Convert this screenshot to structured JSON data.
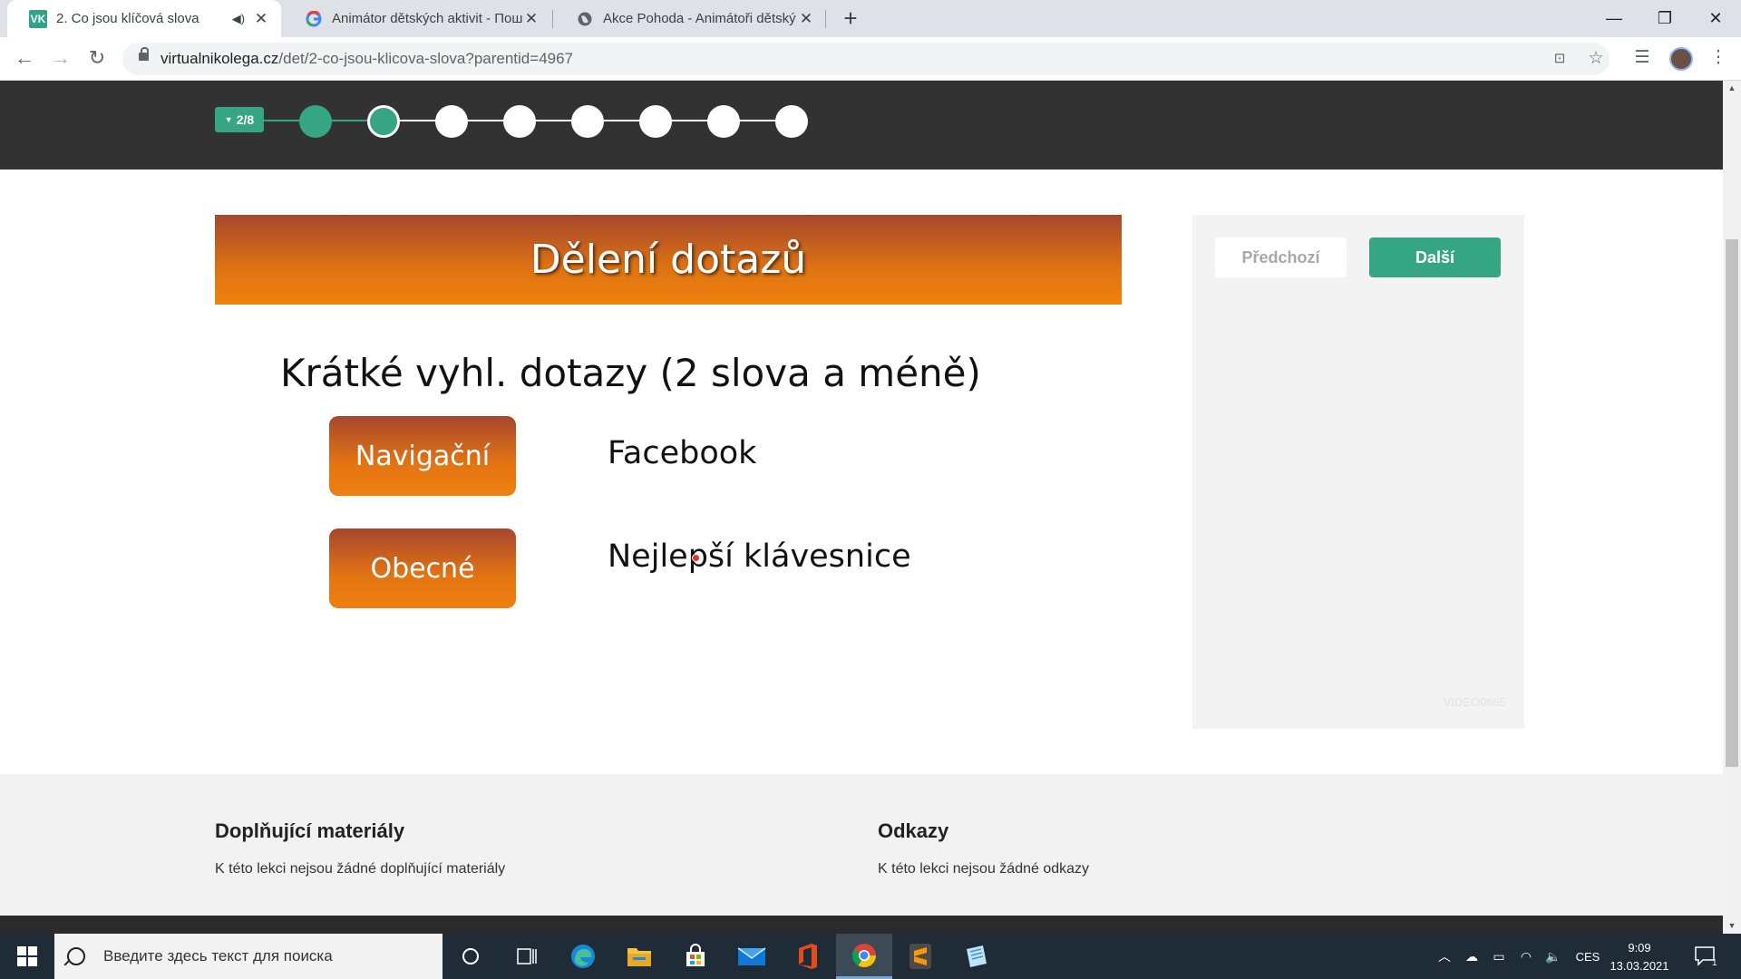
{
  "browser": {
    "tabs": [
      {
        "title": "2. Co jsou klíčová slova",
        "favicon": "vk",
        "active": true,
        "audio": true
      },
      {
        "title": "Animátor dětských aktivit - Пошу",
        "favicon": "google"
      },
      {
        "title": "Akce Pohoda - Animátoři dětský",
        "favicon": "globe"
      }
    ],
    "favicon_vk": "VK",
    "url_domain": "virtualnikolega.cz",
    "url_path": "/det/2-co-jsou-klicova-slova?parentid=4967"
  },
  "progress": {
    "badge": "2/8",
    "total_steps": 8,
    "current_step": 2
  },
  "slide": {
    "title": "Dělení dotazů",
    "subtitle": "Krátké vyhl. dotazy (2 slova a méně)",
    "rows": [
      {
        "category": "Navigační",
        "example": "Facebook"
      },
      {
        "category": "Obecné",
        "example": "Nejlepší klávesnice"
      }
    ],
    "playback_fraction": 0.95
  },
  "side_panel": {
    "prev_label": "Předchozí",
    "next_label": "Další",
    "video_code": "VIDEO0665"
  },
  "footer": {
    "materials_title": "Doplňující materiály",
    "materials_text": "K této lekci nejsou žádné doplňující materiály",
    "links_title": "Odkazy",
    "links_text": "K této lekci nejsou žádné odkazy"
  },
  "taskbar": {
    "search_placeholder": "Введите здесь текст для поиска",
    "language": "CES",
    "time": "9:09",
    "date": "13.03.2021",
    "notification_count": "1"
  },
  "colors": {
    "accent_green": "#35a584",
    "header_orange": "#f0820d",
    "header_brown": "#a6472e",
    "dark_bar": "#323232"
  }
}
